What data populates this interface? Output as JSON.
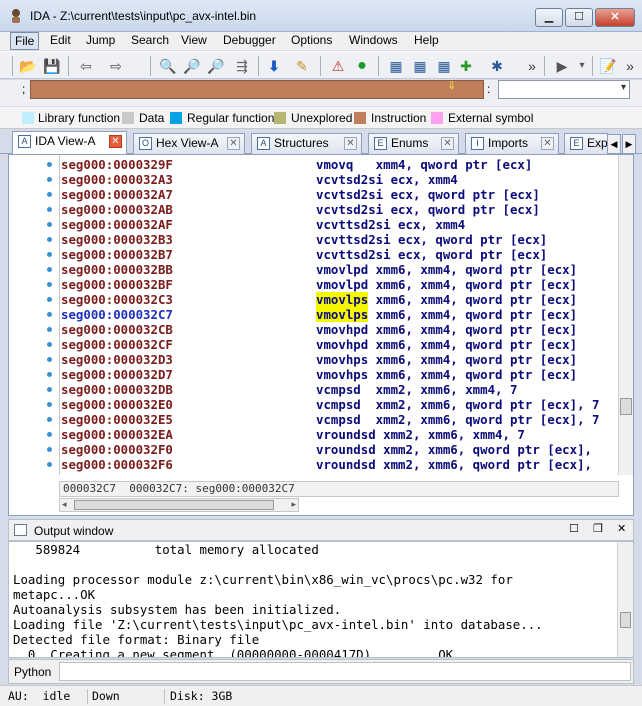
{
  "window": {
    "title": "IDA - Z:\\current\\tests\\input\\pc_avx-intel.bin",
    "min_label": "▁",
    "max_label": "☐",
    "close_label": "✕"
  },
  "menu": [
    "File",
    "Edit",
    "Jump",
    "Search",
    "View",
    "Debugger",
    "Options",
    "Windows",
    "Help"
  ],
  "navbar": {
    "semicolon": ";",
    "colon": ":",
    "marker": "⇓"
  },
  "legend": [
    {
      "label": "Library function",
      "color": "#bfefff"
    },
    {
      "label": "Data",
      "color": "#c8c8c8"
    },
    {
      "label": "Regular function",
      "color": "#00a2e8"
    },
    {
      "label": "Unexplored",
      "color": "#b5b574"
    },
    {
      "label": "Instruction",
      "color": "#c07f5a"
    },
    {
      "label": "External symbol",
      "color": "#ff9ff0"
    }
  ],
  "tabs": [
    {
      "label": "IDA View-A",
      "icon": "A"
    },
    {
      "label": "Hex View-A",
      "icon": "O"
    },
    {
      "label": "Structures",
      "icon": "A"
    },
    {
      "label": "Enums",
      "icon": "E"
    },
    {
      "label": "Imports",
      "icon": "I"
    },
    {
      "label": "Exp",
      "icon": "E"
    }
  ],
  "code": [
    {
      "addr": "seg000:0000329F",
      "text": "vmovq   xmm4, qword ptr [ecx]"
    },
    {
      "addr": "seg000:000032A3",
      "text": "vcvtsd2si ecx, xmm4"
    },
    {
      "addr": "seg000:000032A7",
      "text": "vcvtsd2si ecx, qword ptr [ecx]"
    },
    {
      "addr": "seg000:000032AB",
      "text": "vcvtsd2si ecx, qword ptr [ecx]"
    },
    {
      "addr": "seg000:000032AF",
      "text": "vcvttsd2si ecx, xmm4"
    },
    {
      "addr": "seg000:000032B3",
      "text": "vcvttsd2si ecx, qword ptr [ecx]"
    },
    {
      "addr": "seg000:000032B7",
      "text": "vcvttsd2si ecx, qword ptr [ecx]"
    },
    {
      "addr": "seg000:000032BB",
      "text": "vmovlpd xmm6, xmm4, qword ptr [ecx]"
    },
    {
      "addr": "seg000:000032BF",
      "text": "vmovlpd xmm6, xmm4, qword ptr [ecx]"
    },
    {
      "addr": "seg000:000032C3",
      "mnem": "vmovlps",
      "text": " xmm6, xmm4, qword ptr [ecx]",
      "highlight": true
    },
    {
      "addr": "seg000:000032C7",
      "mnem": "vmovlps",
      "text": " xmm6, xmm4, qword ptr [ecx]",
      "highlight": true,
      "current": true
    },
    {
      "addr": "seg000:000032CB",
      "text": "vmovhpd xmm6, xmm4, qword ptr [ecx]"
    },
    {
      "addr": "seg000:000032CF",
      "text": "vmovhpd xmm6, xmm4, qword ptr [ecx]"
    },
    {
      "addr": "seg000:000032D3",
      "text": "vmovhps xmm6, xmm4, qword ptr [ecx]"
    },
    {
      "addr": "seg000:000032D7",
      "text": "vmovhps xmm6, xmm4, qword ptr [ecx]"
    },
    {
      "addr": "seg000:000032DB",
      "text": "vcmpsd  xmm2, xmm6, xmm4, 7"
    },
    {
      "addr": "seg000:000032E0",
      "text": "vcmpsd  xmm2, xmm6, qword ptr [ecx], 7"
    },
    {
      "addr": "seg000:000032E5",
      "text": "vcmpsd  xmm2, xmm6, qword ptr [ecx], 7"
    },
    {
      "addr": "seg000:000032EA",
      "text": "vroundsd xmm2, xmm6, xmm4, 7"
    },
    {
      "addr": "seg000:000032F0",
      "text": "vroundsd xmm2, xmm6, qword ptr [ecx],"
    },
    {
      "addr": "seg000:000032F6",
      "text": "vroundsd xmm2, xmm6, qword ptr [ecx],"
    }
  ],
  "ida_status": "000032C7  000032C7: seg000:000032C7",
  "output": {
    "title": "Output window",
    "lines": [
      "   589824          total memory allocated",
      "",
      "Loading processor module z:\\current\\bin\\x86_win_vc\\procs\\pc.w32 for",
      "metapc...OK",
      "Autoanalysis subsystem has been initialized.",
      "Loading file 'Z:\\current\\tests\\input\\pc_avx-intel.bin' into database...",
      "Detected file format: Binary file",
      "  0. Creating a new segment  (00000000-0000417D) ... ... OK"
    ]
  },
  "python_label": "Python",
  "statusbar": {
    "au": "AU:  idle",
    "state": "Down",
    "disk": "Disk: 3GB"
  }
}
